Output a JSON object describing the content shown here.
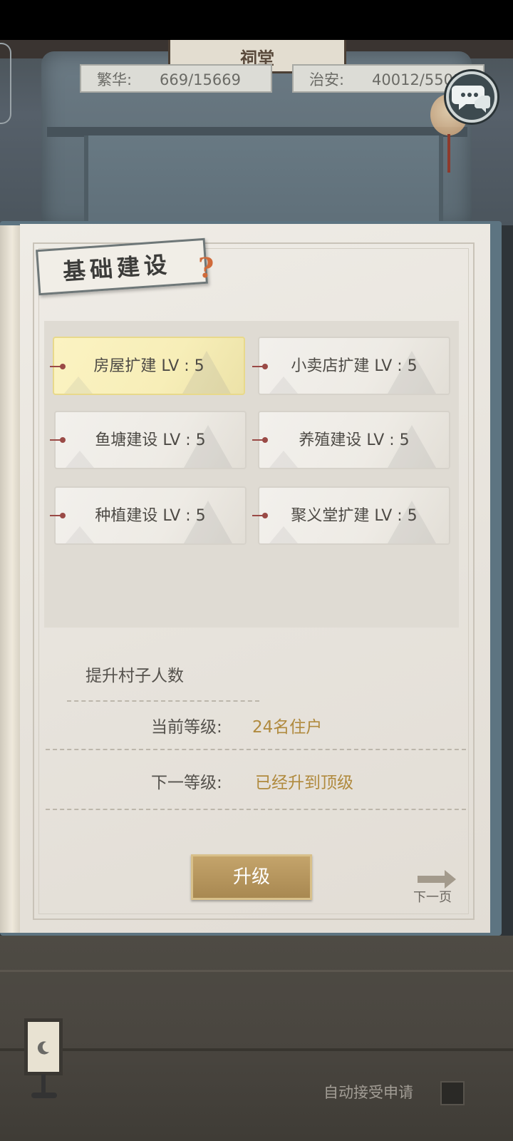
{
  "hall_sign": "祠堂",
  "resources": {
    "prosperity": {
      "label": "繁华:",
      "value": "669/15669"
    },
    "security": {
      "label": "治安:",
      "value": "40012/55012"
    }
  },
  "panel": {
    "title": "基础建设",
    "help_glyph": "?"
  },
  "buildings": [
    {
      "label": "房屋扩建 LV : 5",
      "selected": true
    },
    {
      "label": "小卖店扩建 LV : 5",
      "selected": false
    },
    {
      "label": "鱼塘建设 LV : 5",
      "selected": false
    },
    {
      "label": "养殖建设 LV : 5",
      "selected": false
    },
    {
      "label": "种植建设 LV : 5",
      "selected": false
    },
    {
      "label": "聚义堂扩建 LV : 5",
      "selected": false
    }
  ],
  "detail": {
    "description": "提升村子人数",
    "current_label": "当前等级:",
    "current_value": "24名住户",
    "next_label": "下一等级:",
    "next_value": "已经升到顶级"
  },
  "upgrade_label": "升级",
  "next_page_label": "下一页",
  "auto_accept_label": "自动接受申请",
  "icons": {
    "chat": "chat-bubble-icon",
    "help": "question-icon",
    "next": "arrow-right-icon",
    "lamp": "lantern-icon"
  },
  "colors": {
    "accent_gold": "#b08a3e",
    "button": "#b8985e",
    "selected_card": "#f7eeb8"
  }
}
